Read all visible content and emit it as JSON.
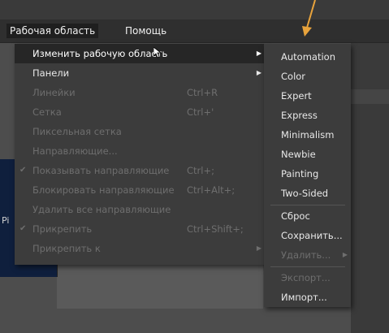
{
  "menubar": {
    "items": [
      {
        "label": "Рабочая область"
      },
      {
        "label": "Помощь"
      }
    ]
  },
  "main_menu": {
    "items": [
      {
        "label": "Изменить рабочую область",
        "shortcut": "",
        "submenu": true,
        "enabled": true,
        "checked": false,
        "highlight": true
      },
      {
        "label": "Панели",
        "shortcut": "",
        "submenu": true,
        "enabled": true,
        "checked": false,
        "highlight": false
      },
      {
        "label": "Линейки",
        "shortcut": "Ctrl+R",
        "submenu": false,
        "enabled": false,
        "checked": false,
        "highlight": false
      },
      {
        "label": "Сетка",
        "shortcut": "Ctrl+'",
        "submenu": false,
        "enabled": false,
        "checked": false,
        "highlight": false
      },
      {
        "label": "Пиксельная сетка",
        "shortcut": "",
        "submenu": false,
        "enabled": false,
        "checked": false,
        "highlight": false
      },
      {
        "label": "Направляющие...",
        "shortcut": "",
        "submenu": false,
        "enabled": false,
        "checked": false,
        "highlight": false
      },
      {
        "label": "Показывать направляющие",
        "shortcut": "Ctrl+;",
        "submenu": false,
        "enabled": false,
        "checked": true,
        "highlight": false
      },
      {
        "label": "Блокировать направляющие",
        "shortcut": "Ctrl+Alt+;",
        "submenu": false,
        "enabled": false,
        "checked": false,
        "highlight": false
      },
      {
        "label": "Удалить все направляющие",
        "shortcut": "",
        "submenu": false,
        "enabled": false,
        "checked": false,
        "highlight": false
      },
      {
        "label": "Прикрепить",
        "shortcut": "Ctrl+Shift+;",
        "submenu": false,
        "enabled": false,
        "checked": true,
        "highlight": false
      },
      {
        "label": "Прикрепить к",
        "shortcut": "",
        "submenu": true,
        "enabled": false,
        "checked": false,
        "highlight": false
      }
    ]
  },
  "sub_menu": {
    "items": [
      {
        "label": "Automation",
        "enabled": true,
        "submenu": false
      },
      {
        "label": "Color",
        "enabled": true,
        "submenu": false
      },
      {
        "label": "Expert",
        "enabled": true,
        "submenu": false
      },
      {
        "label": "Express",
        "enabled": true,
        "submenu": false
      },
      {
        "label": "Minimalism",
        "enabled": true,
        "submenu": false
      },
      {
        "label": "Newbie",
        "enabled": true,
        "submenu": false
      },
      {
        "label": "Painting",
        "enabled": true,
        "submenu": false
      },
      {
        "label": "Two-Sided",
        "enabled": true,
        "submenu": false
      },
      {
        "label": "Сброс",
        "enabled": true,
        "submenu": false
      },
      {
        "label": "Сохранить...",
        "enabled": true,
        "submenu": false
      },
      {
        "label": "Удалить...",
        "enabled": false,
        "submenu": true
      },
      {
        "label": "Экспорт...",
        "enabled": false,
        "submenu": false
      },
      {
        "label": "Импорт...",
        "enabled": true,
        "submenu": false
      }
    ]
  },
  "background": {
    "left_label": "Pi"
  },
  "colors": {
    "accent_arrow": "#e8a33c",
    "menu_bg": "#3c3c3c",
    "highlight_bg": "#262626",
    "disabled_text": "#6e6e6e"
  }
}
